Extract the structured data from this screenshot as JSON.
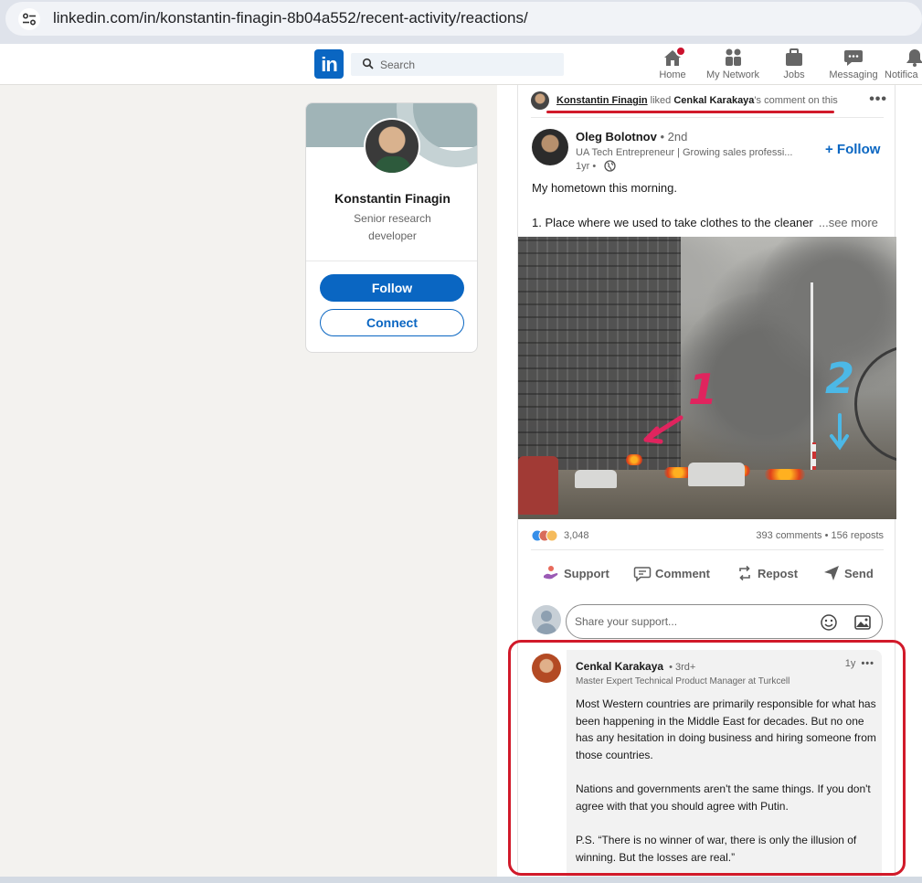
{
  "browser": {
    "url": "linkedin.com/in/konstantin-finagin-8b04a552/recent-activity/reactions/"
  },
  "nav": {
    "logo": "in",
    "search_placeholder": "Search",
    "items": [
      {
        "label": "Home",
        "icon": "home-icon"
      },
      {
        "label": "My Network",
        "icon": "network-icon"
      },
      {
        "label": "Jobs",
        "icon": "jobs-icon"
      },
      {
        "label": "Messaging",
        "icon": "messaging-icon"
      },
      {
        "label": "Notifica",
        "icon": "notifications-icon"
      }
    ]
  },
  "profile": {
    "name": "Konstantin Finagin",
    "headline": "Senior research developer",
    "follow_label": "Follow",
    "connect_label": "Connect"
  },
  "post": {
    "activity": {
      "actor": "Konstantin Finagin",
      "verb": "liked",
      "target_name": "Cenkal Karakaya",
      "target_suffix": "'s comment on this"
    },
    "author": {
      "name": "Oleg Bolotnov",
      "degree": "• 2nd",
      "headline": "UA Tech Entrepreneur | Growing sales professi...",
      "time": "1yr •",
      "follow_label": "+ Follow"
    },
    "text_line1": "My hometown this morning.",
    "text_line2": "1. Place where we used to take clothes to the cleaner",
    "see_more": "...see more",
    "image_marks": [
      "1",
      "2"
    ],
    "reaction_count": "3,048",
    "stats": "393 comments • 156 reposts",
    "actions": [
      {
        "label": "Support",
        "icon": "support-icon"
      },
      {
        "label": "Comment",
        "icon": "comment-icon"
      },
      {
        "label": "Repost",
        "icon": "repost-icon"
      },
      {
        "label": "Send",
        "icon": "send-icon"
      }
    ],
    "comment_placeholder": "Share your support..."
  },
  "comment": {
    "name": "Cenkal Karakaya",
    "degree": "• 3rd+",
    "time": "1y",
    "headline": "Master Expert Technical Product Manager at Turkcell",
    "paragraphs": [
      "Most Western countries are primarily responsible for what has been happening in the Middle East for decades. But no one has any hesitation in doing business and hiring someone from those countries.",
      "Nations and governments aren't the same things. If you don't agree with that you should agree with Putin.",
      "P.S. “There is no winner of war, there is only the illusion of winning. But the losses are real.”"
    ]
  },
  "colors": {
    "brand": "#0a66c2",
    "highlight": "#d11a2a"
  }
}
